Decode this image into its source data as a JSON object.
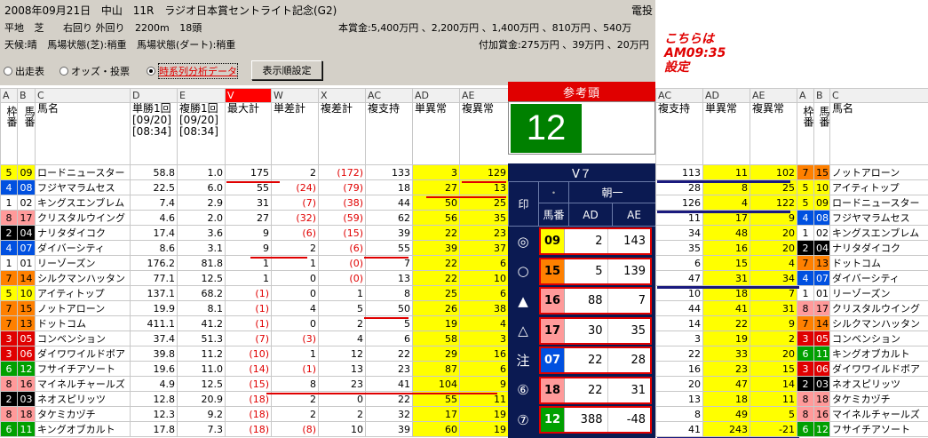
{
  "header": {
    "line1": [
      "2008年09月21日",
      "中山",
      "11R",
      "ラジオ日本賞セントライト記念(G2)",
      "電投"
    ],
    "line2": [
      "平地",
      "芝",
      "右回り 外回り",
      "2200m",
      "18頭"
    ],
    "line2r": "本賞金:5,400万円 、2,200万円 、1,400万円 、810万円 、540万",
    "line3": [
      "天候:晴",
      "馬場状態(芝):稍重",
      "馬場状態(ダート):稍重"
    ],
    "line3r": "付加賞金:275万円 、39万円 、20万円"
  },
  "options": {
    "o1": "出走表",
    "o2": "オッズ・投票",
    "o3": "時系列分析データ",
    "button": "表示順設定"
  },
  "note": [
    "こちらは",
    "AM09:35",
    "設定"
  ],
  "left": {
    "colletters": [
      "A",
      "B",
      "C",
      "D",
      "E",
      "V",
      "W",
      "X",
      "AC",
      "AD",
      "AE"
    ],
    "subheads": [
      "枠番",
      "馬番",
      "馬名",
      "単勝1回[09/20][08:34]",
      "複勝1回[09/20][08:34]",
      "最大計",
      "単差計",
      "複差計",
      "複支持",
      "単異常",
      "複異常"
    ],
    "rows": [
      [
        "5",
        "09",
        "ロードニュースター",
        "58.8",
        "1.0",
        "175",
        "2",
        "(172)",
        "133",
        "3",
        "129"
      ],
      [
        "4",
        "08",
        "フジヤマラムセス",
        "22.5",
        "6.0",
        "55",
        "(24)",
        "(79)",
        "18",
        "27",
        "13"
      ],
      [
        "1",
        "02",
        "キングスエンブレム",
        "7.4",
        "2.9",
        "31",
        "(7)",
        "(38)",
        "44",
        "50",
        "25"
      ],
      [
        "8",
        "17",
        "クリスタルウイング",
        "4.6",
        "2.0",
        "27",
        "(32)",
        "(59)",
        "62",
        "56",
        "35"
      ],
      [
        "2",
        "04",
        "ナリタダイコク",
        "17.4",
        "3.6",
        "9",
        "(6)",
        "(15)",
        "39",
        "22",
        "23"
      ],
      [
        "4",
        "07",
        "ダイバーシティ",
        "8.6",
        "3.1",
        "9",
        "2",
        "(6)",
        "55",
        "39",
        "37"
      ],
      [
        "1",
        "01",
        "リーゾーズン",
        "176.2",
        "81.8",
        "1",
        "1",
        "(0)",
        "7",
        "22",
        "6"
      ],
      [
        "7",
        "14",
        "シルクマンハッタン",
        "77.1",
        "12.5",
        "1",
        "0",
        "(0)",
        "13",
        "22",
        "10"
      ],
      [
        "5",
        "10",
        "アイティトップ",
        "137.1",
        "68.2",
        "(1)",
        "0",
        "1",
        "8",
        "25",
        "6"
      ],
      [
        "7",
        "15",
        "ノットアローン",
        "19.9",
        "8.1",
        "(1)",
        "4",
        "5",
        "50",
        "26",
        "38"
      ],
      [
        "7",
        "13",
        "ドットコム",
        "411.1",
        "41.2",
        "(1)",
        "0",
        "2",
        "5",
        "19",
        "4"
      ],
      [
        "3",
        "05",
        "コンベンション",
        "37.4",
        "51.3",
        "(7)",
        "(3)",
        "4",
        "6",
        "58",
        "3"
      ],
      [
        "3",
        "06",
        "ダイワワイルドボア",
        "39.8",
        "11.2",
        "(10)",
        "1",
        "12",
        "22",
        "29",
        "16"
      ],
      [
        "6",
        "12",
        "フサイチアソート",
        "19.6",
        "11.0",
        "(14)",
        "(1)",
        "13",
        "23",
        "87",
        "6"
      ],
      [
        "8",
        "16",
        "マイネルチャールズ",
        "4.9",
        "12.5",
        "(15)",
        "8",
        "23",
        "41",
        "104",
        "9"
      ],
      [
        "2",
        "03",
        "ネオスピリッツ",
        "12.8",
        "20.9",
        "(18)",
        "2",
        "0",
        "22",
        "55",
        "11"
      ],
      [
        "8",
        "18",
        "タケミカヅチ",
        "12.3",
        "9.2",
        "(18)",
        "2",
        "2",
        "32",
        "17",
        "19"
      ],
      [
        "6",
        "11",
        "キングオブカルト",
        "17.8",
        "7.3",
        "(18)",
        "(8)",
        "10",
        "39",
        "60",
        "19"
      ]
    ]
  },
  "mid": {
    "title": "参考頭",
    "pick": "12",
    "v7": "V７",
    "asa": "朝一",
    "h_mark": "印",
    "h_umaban": "馬番",
    "h_ad": "AD",
    "h_ae": "AE",
    "dot": "・",
    "rows": [
      {
        "mark": "◎",
        "no": "09",
        "ad": "2",
        "ae": "143",
        "wc": "w5"
      },
      {
        "mark": "○",
        "no": "15",
        "ad": "5",
        "ae": "139",
        "wc": "w7"
      },
      {
        "mark": "▲",
        "no": "16",
        "ad": "88",
        "ae": "7",
        "wc": "w8"
      },
      {
        "mark": "△",
        "no": "17",
        "ad": "30",
        "ae": "35",
        "wc": "w8"
      },
      {
        "mark": "注",
        "no": "07",
        "ad": "22",
        "ae": "28",
        "wc": "w4"
      },
      {
        "mark": "⑥",
        "no": "18",
        "ad": "22",
        "ae": "31",
        "wc": "w8"
      },
      {
        "mark": "⑦",
        "no": "12",
        "ad": "388",
        "ae": "-48",
        "wc": "w6"
      }
    ]
  },
  "right": {
    "colletters": [
      "AC",
      "AD",
      "AE",
      "A",
      "B",
      "C"
    ],
    "subheads": [
      "複支持",
      "単異常",
      "複異常",
      "枠番",
      "馬番",
      "馬名"
    ],
    "rows": [
      [
        "113",
        "11",
        "102",
        "7",
        "15",
        "ノットアローン"
      ],
      [
        "28",
        "8",
        "25",
        "5",
        "10",
        "アイティトップ"
      ],
      [
        "126",
        "4",
        "122",
        "5",
        "09",
        "ロードニュースター"
      ],
      [
        "11",
        "17",
        "9",
        "4",
        "08",
        "フジヤマラムセス"
      ],
      [
        "34",
        "48",
        "20",
        "1",
        "02",
        "キングスエンブレム"
      ],
      [
        "35",
        "16",
        "20",
        "2",
        "04",
        "ナリタダイコク"
      ],
      [
        "6",
        "15",
        "4",
        "7",
        "13",
        "ドットコム"
      ],
      [
        "47",
        "31",
        "34",
        "4",
        "07",
        "ダイバーシティ"
      ],
      [
        "10",
        "18",
        "7",
        "1",
        "01",
        "リーゾーズン"
      ],
      [
        "44",
        "41",
        "31",
        "8",
        "17",
        "クリスタルウイング"
      ],
      [
        "14",
        "22",
        "9",
        "7",
        "14",
        "シルクマンハッタン"
      ],
      [
        "3",
        "19",
        "2",
        "3",
        "05",
        "コンベンション"
      ],
      [
        "22",
        "33",
        "20",
        "6",
        "11",
        "キングオブカルト"
      ],
      [
        "16",
        "23",
        "15",
        "3",
        "06",
        "ダイワワイルドボア"
      ],
      [
        "20",
        "47",
        "14",
        "2",
        "03",
        "ネオスピリッツ"
      ],
      [
        "13",
        "18",
        "11",
        "8",
        "18",
        "タケミカヅチ"
      ],
      [
        "8",
        "49",
        "5",
        "8",
        "16",
        "マイネルチャールズ"
      ],
      [
        "41",
        "243",
        "-21",
        "6",
        "12",
        "フサイチアソート"
      ]
    ]
  }
}
